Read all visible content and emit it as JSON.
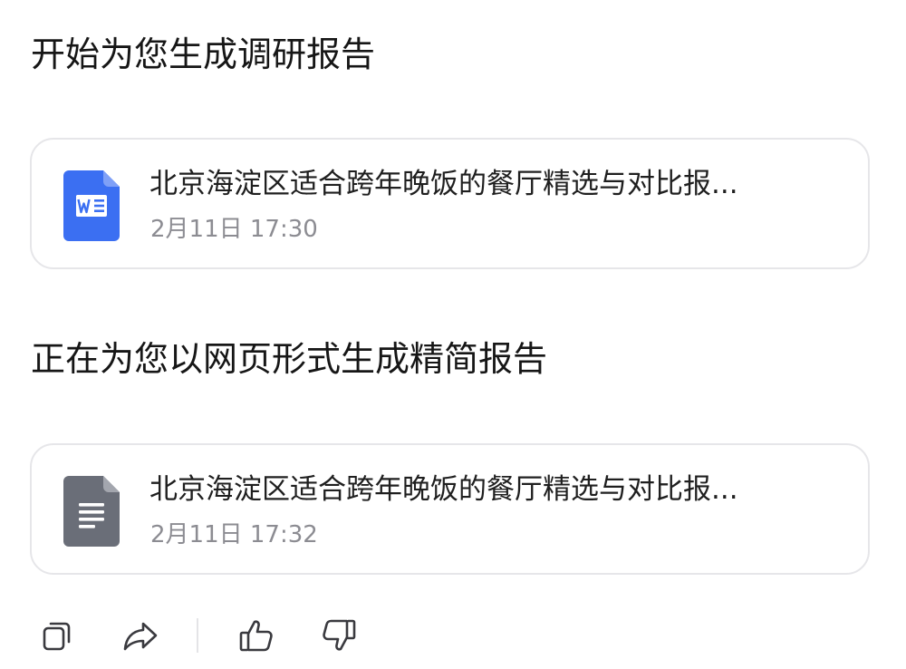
{
  "status_start": "开始为您生成调研报告",
  "status_web": "正在为您以网页形式生成精简报告",
  "cards": [
    {
      "icon": "word-document-icon",
      "icon_color": "#3b6ff2",
      "title": "北京海淀区适合跨年晚饭的餐厅精选与对比报...",
      "time": "2月11日 17:30"
    },
    {
      "icon": "text-document-icon",
      "icon_color": "#6a6e78",
      "title": "北京海淀区适合跨年晚饭的餐厅精选与对比报...",
      "time": "2月11日 17:32"
    }
  ],
  "actions": {
    "icons": [
      "copy-icon",
      "share-icon",
      "thumbs-up-icon",
      "thumbs-down-icon"
    ],
    "icon_color": "#3a3a3f"
  },
  "colors": {
    "card_border": "#e6e6e9",
    "secondary_text": "#8c8c92"
  }
}
